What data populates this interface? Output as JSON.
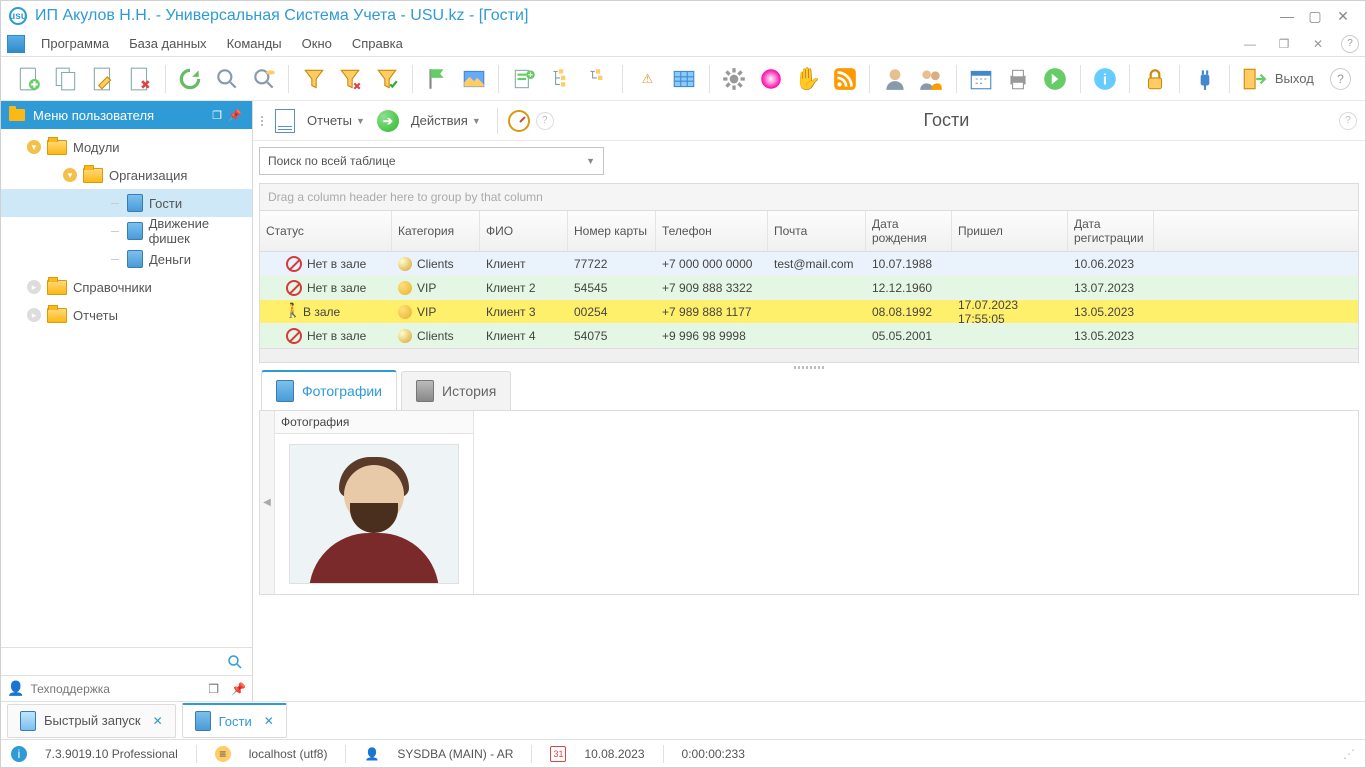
{
  "window": {
    "title": "ИП Акулов Н.Н. - Универсальная Система Учета - USU.kz - [Гости]"
  },
  "menubar": {
    "items": [
      "Программа",
      "База данных",
      "Команды",
      "Окно",
      "Справка"
    ]
  },
  "toolbar": {
    "exit_label": "Выход"
  },
  "sidebar": {
    "header": "Меню пользователя",
    "tree": {
      "modules": "Модули",
      "organization": "Организация",
      "guests": "Гости",
      "chips_movement": "Движение фишек",
      "money": "Деньги",
      "directories": "Справочники",
      "reports": "Отчеты"
    },
    "support": "Техподдержка"
  },
  "main": {
    "reports_btn": "Отчеты",
    "actions_btn": "Действия",
    "title": "Гости",
    "search_placeholder": "Поиск по всей таблице",
    "group_hint": "Drag a column header here to group by that column",
    "columns": {
      "status": "Статус",
      "category": "Категория",
      "fio": "ФИО",
      "card": "Номер карты",
      "phone": "Телефон",
      "mail": "Почта",
      "dob": "Дата рождения",
      "came": "Пришел",
      "reg": "Дата регистрации"
    },
    "rows": [
      {
        "status": "Нет в зале",
        "cat": "Clients",
        "catIcon": "clients",
        "fio": "Клиент",
        "card": "77722",
        "phone": "+7 000 000 0000",
        "mail": "test@mail.com",
        "dob": "10.07.1988",
        "came": "",
        "reg": "10.06.2023",
        "css": "blue",
        "in": false
      },
      {
        "status": "Нет в зале",
        "cat": "VIP",
        "catIcon": "vip",
        "fio": "Клиент 2",
        "card": "54545",
        "phone": "+7 909 888 3322",
        "mail": "",
        "dob": "12.12.1960",
        "came": "",
        "reg": "13.07.2023",
        "css": "green",
        "in": false
      },
      {
        "status": "В зале",
        "cat": "VIP",
        "catIcon": "vip",
        "fio": "Клиент 3",
        "card": "00254",
        "phone": "+7 989 888 1177",
        "mail": "",
        "dob": "08.08.1992",
        "came": "17.07.2023 17:55:05",
        "reg": "13.05.2023",
        "css": "yellow",
        "in": true
      },
      {
        "status": "Нет в зале",
        "cat": "Clients",
        "catIcon": "clients",
        "fio": "Клиент 4",
        "card": "54075",
        "phone": "+9 996 98 9998",
        "mail": "",
        "dob": "05.05.2001",
        "came": "",
        "reg": "13.05.2023",
        "css": "green",
        "in": false
      }
    ]
  },
  "detail": {
    "tab_photos": "Фотографии",
    "tab_history": "История",
    "photo_col": "Фотография"
  },
  "bottom_tabs": {
    "quick_launch": "Быстрый запуск",
    "guests": "Гости"
  },
  "statusbar": {
    "version": "7.3.9019.10 Professional",
    "connection": "localhost (utf8)",
    "user": "SYSDBA (MAIN) - AR",
    "date": "10.08.2023",
    "timer": "0:00:00:233"
  }
}
